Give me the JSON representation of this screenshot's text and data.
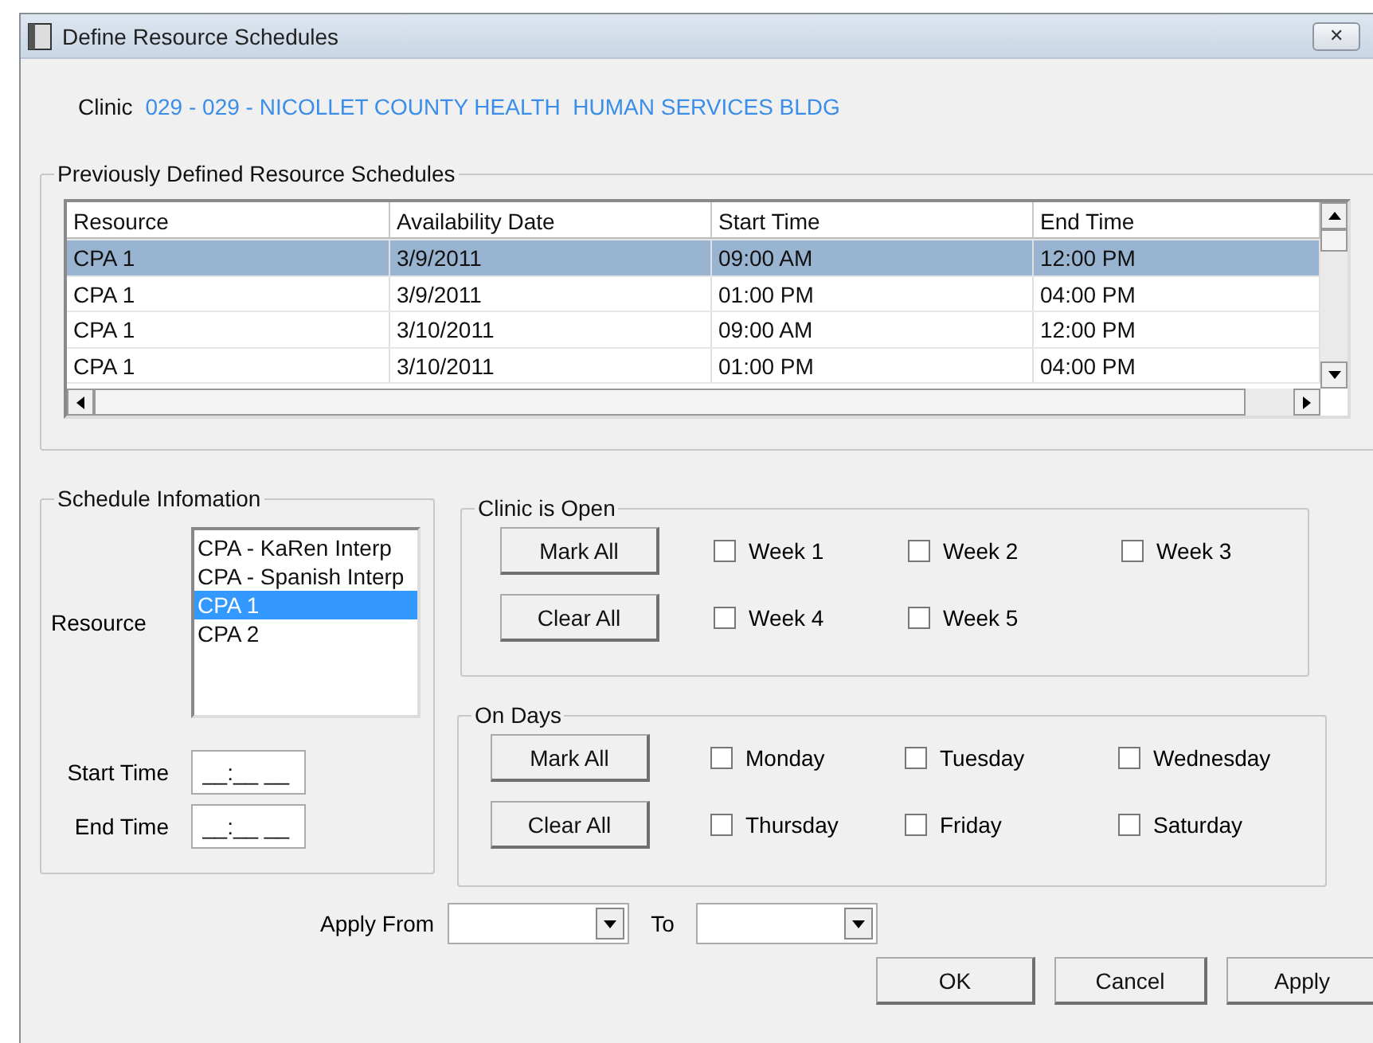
{
  "window": {
    "title": "Define Resource Schedules",
    "close": "✕"
  },
  "clinic": {
    "label": "Clinic",
    "value": "029 - 029 - NICOLLET COUNTY HEALTH  HUMAN SERVICES BLDG"
  },
  "schedules": {
    "title": "Previously Defined Resource Schedules",
    "columns": [
      "Resource",
      "Availability Date",
      "Start Time",
      "End Time"
    ],
    "rows": [
      {
        "cells": [
          "CPA 1",
          "3/9/2011",
          "09:00 AM",
          "12:00 PM"
        ],
        "selected": true
      },
      {
        "cells": [
          "CPA 1",
          "3/9/2011",
          "01:00 PM",
          "04:00 PM"
        ],
        "selected": false
      },
      {
        "cells": [
          "CPA 1",
          "3/10/2011",
          "09:00 AM",
          "12:00 PM"
        ],
        "selected": false
      },
      {
        "cells": [
          "CPA 1",
          "3/10/2011",
          "01:00 PM",
          "04:00 PM"
        ],
        "selected": false
      }
    ]
  },
  "schedule_info": {
    "title": "Schedule Infomation",
    "resource_label": "Resource",
    "resources": [
      {
        "label": "CPA - KaRen Interp",
        "selected": false
      },
      {
        "label": "CPA - Spanish Interp",
        "selected": false
      },
      {
        "label": "CPA 1",
        "selected": true
      },
      {
        "label": "CPA 2",
        "selected": false
      }
    ],
    "start_time": {
      "label": "Start Time",
      "value": "__:__ __"
    },
    "end_time": {
      "label": "End Time",
      "value": "__:__ __"
    }
  },
  "clinic_open": {
    "title": "Clinic is Open",
    "mark_all": "Mark All",
    "clear_all": "Clear All",
    "options": [
      {
        "label": "Week 1",
        "checked": false
      },
      {
        "label": "Week 2",
        "checked": false
      },
      {
        "label": "Week 3",
        "checked": false
      },
      {
        "label": "Week 4",
        "checked": false
      },
      {
        "label": "Week 5",
        "checked": false
      }
    ]
  },
  "on_days": {
    "title": "On Days",
    "mark_all": "Mark All",
    "clear_all": "Clear All",
    "options": [
      {
        "label": "Monday",
        "checked": false
      },
      {
        "label": "Tuesday",
        "checked": false
      },
      {
        "label": "Wednesday",
        "checked": false
      },
      {
        "label": "Thursday",
        "checked": false
      },
      {
        "label": "Friday",
        "checked": false
      },
      {
        "label": "Saturday",
        "checked": false
      }
    ]
  },
  "apply_from": {
    "label": "Apply From",
    "to_label": "To"
  },
  "buttons": [
    "OK",
    "Cancel",
    "Apply"
  ]
}
